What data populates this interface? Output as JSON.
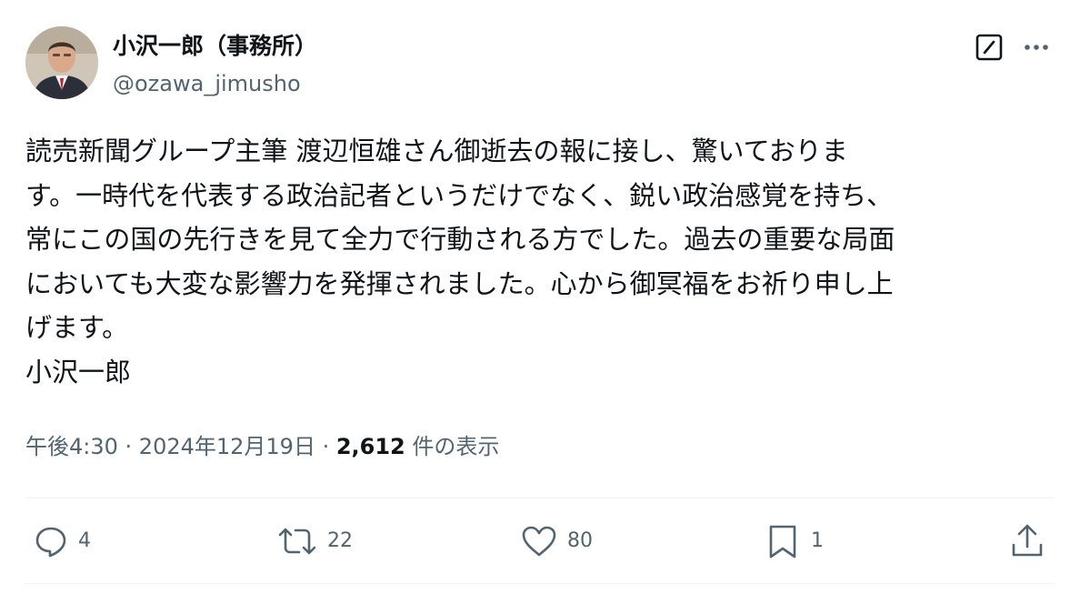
{
  "author": {
    "display_name": "小沢一郎（事務所）",
    "handle": "@ozawa_jimusho"
  },
  "tweet": {
    "lines": [
      "読売新聞グループ主筆  渡辺恒雄さん御逝去の報に接し、驚いておりま",
      "す。一時代を代表する政治記者というだけでなく、鋭い政治感覚を持ち、",
      "常にこの国の先行きを見て全力で行動される方でした。過去の重要な局面",
      "においても大変な影響力を発揮されました。心から御冥福をお祈り申し上",
      "げます。",
      "小沢一郎"
    ]
  },
  "meta": {
    "time": "午後4:30",
    "separator": " · ",
    "date": "2024年12月19日",
    "views_count": "2,612",
    "views_label": " 件の表示"
  },
  "actions": {
    "reply_count": "4",
    "retweet_count": "22",
    "like_count": "80",
    "bookmark_count": "1"
  },
  "icons": {
    "grok": "grok-icon",
    "more": "more-icon",
    "reply": "reply-icon",
    "retweet": "retweet-icon",
    "like": "heart-icon",
    "bookmark": "bookmark-icon",
    "share": "share-icon"
  },
  "colors": {
    "text": "#0f1419",
    "secondary": "#536471",
    "divider": "#eff3f4"
  }
}
